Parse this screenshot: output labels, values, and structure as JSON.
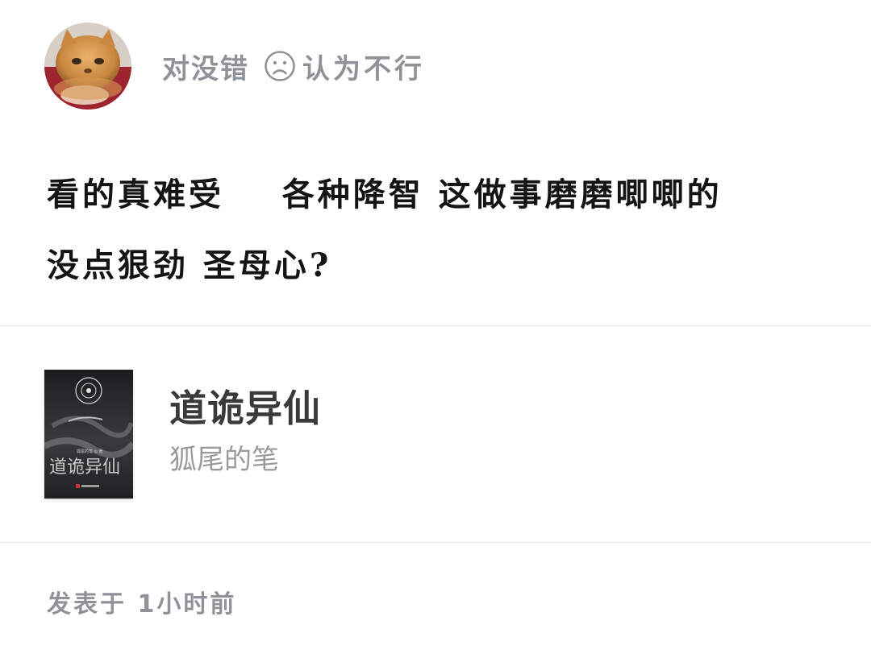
{
  "post": {
    "author_name": "对没错",
    "reaction": {
      "icon": "frown-face-icon",
      "label": "认为不行"
    },
    "comment_line1": "看的真难受    各种降智 这做事磨磨唧唧的",
    "comment_line2": "没点狠劲 圣母心?",
    "posted_time": "发表于 1小时前"
  },
  "book": {
    "title": "道诡异仙",
    "author": "狐尾的笔",
    "cover_title": "道诡异仙",
    "cover_author": "狐尾的笔 ◎ 著"
  },
  "colors": {
    "meta_text": "#8f9399",
    "body_text": "#141414",
    "book_title": "#3a3a3a",
    "book_author": "#9a9a9a",
    "divider": "#e3e3e3"
  }
}
